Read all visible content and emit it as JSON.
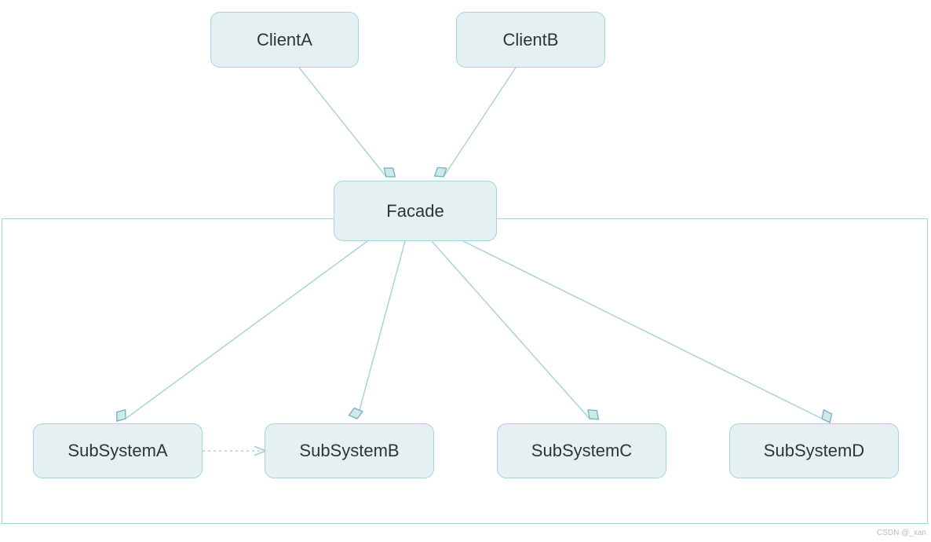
{
  "nodes": {
    "clientA": "ClientA",
    "clientB": "ClientB",
    "facade": "Facade",
    "subA": "SubSystemA",
    "subB": "SubSystemB",
    "subC": "SubSystemC",
    "subD": "SubSystemD"
  },
  "watermark": "CSDN @_xan",
  "colors": {
    "nodeFill": "#e4f0f2",
    "nodeBorder": "#a8d4d8",
    "edge": "#a8d4d8",
    "diamondFill": "#cfe8eb",
    "diamondStroke": "#6fb3ba"
  },
  "diagram": {
    "type": "uml-class-diagram",
    "pattern": "Facade",
    "clients": [
      "ClientA",
      "ClientB"
    ],
    "facade": "Facade",
    "subsystems": [
      "SubSystemA",
      "SubSystemB",
      "SubSystemC",
      "SubSystemD"
    ],
    "relations": [
      {
        "from": "ClientA",
        "to": "Facade",
        "kind": "aggregation"
      },
      {
        "from": "ClientB",
        "to": "Facade",
        "kind": "aggregation"
      },
      {
        "from": "Facade",
        "to": "SubSystemA",
        "kind": "aggregation"
      },
      {
        "from": "Facade",
        "to": "SubSystemB",
        "kind": "aggregation"
      },
      {
        "from": "Facade",
        "to": "SubSystemC",
        "kind": "aggregation"
      },
      {
        "from": "Facade",
        "to": "SubSystemD",
        "kind": "aggregation"
      },
      {
        "from": "SubSystemA",
        "to": "SubSystemB",
        "kind": "dependency"
      }
    ]
  }
}
